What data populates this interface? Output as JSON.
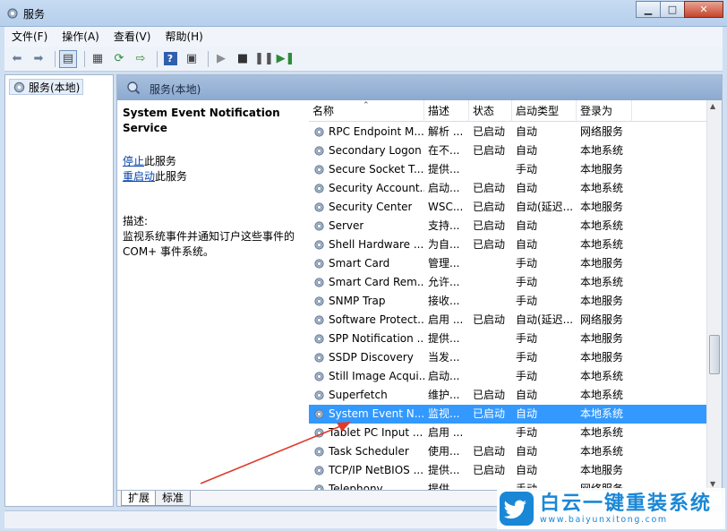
{
  "window": {
    "title": "服务",
    "controls": [
      "minimize-icon",
      "maximize-icon",
      "close-icon"
    ]
  },
  "menu": [
    "文件(F)",
    "操作(A)",
    "查看(V)",
    "帮助(H)"
  ],
  "tree": {
    "root_label": "服务(本地)"
  },
  "panel": {
    "header": "服务(本地)",
    "selected_title": "System Event Notification Service",
    "stop_link": "停止",
    "stop_suffix": "此服务",
    "restart_link": "重启动",
    "restart_suffix": "此服务",
    "desc_label": "描述:",
    "desc_text": "监视系统事件并通知订户这些事件的 COM+ 事件系统。"
  },
  "columns": [
    "名称",
    "描述",
    "状态",
    "启动类型",
    "登录为"
  ],
  "rows": [
    {
      "name": "RPC Endpoint M...",
      "desc": "解析 ...",
      "status": "已启动",
      "type": "自动",
      "logon": "网络服务"
    },
    {
      "name": "Secondary Logon",
      "desc": "在不...",
      "status": "已启动",
      "type": "自动",
      "logon": "本地系统"
    },
    {
      "name": "Secure Socket T...",
      "desc": "提供...",
      "status": "",
      "type": "手动",
      "logon": "本地服务"
    },
    {
      "name": "Security Account...",
      "desc": "启动...",
      "status": "已启动",
      "type": "自动",
      "logon": "本地系统"
    },
    {
      "name": "Security Center",
      "desc": "WSC...",
      "status": "已启动",
      "type": "自动(延迟...",
      "logon": "本地服务"
    },
    {
      "name": "Server",
      "desc": "支持...",
      "status": "已启动",
      "type": "自动",
      "logon": "本地系统"
    },
    {
      "name": "Shell Hardware ...",
      "desc": "为自...",
      "status": "已启动",
      "type": "自动",
      "logon": "本地系统"
    },
    {
      "name": "Smart Card",
      "desc": "管理...",
      "status": "",
      "type": "手动",
      "logon": "本地服务"
    },
    {
      "name": "Smart Card Rem...",
      "desc": "允许...",
      "status": "",
      "type": "手动",
      "logon": "本地系统"
    },
    {
      "name": "SNMP Trap",
      "desc": "接收...",
      "status": "",
      "type": "手动",
      "logon": "本地服务"
    },
    {
      "name": "Software Protect...",
      "desc": "启用 ...",
      "status": "已启动",
      "type": "自动(延迟...",
      "logon": "网络服务"
    },
    {
      "name": "SPP Notification ...",
      "desc": "提供...",
      "status": "",
      "type": "手动",
      "logon": "本地服务"
    },
    {
      "name": "SSDP Discovery",
      "desc": "当发...",
      "status": "",
      "type": "手动",
      "logon": "本地服务"
    },
    {
      "name": "Still Image Acqui...",
      "desc": "启动...",
      "status": "",
      "type": "手动",
      "logon": "本地系统"
    },
    {
      "name": "Superfetch",
      "desc": "维护...",
      "status": "已启动",
      "type": "自动",
      "logon": "本地系统"
    },
    {
      "name": "System Event N...",
      "desc": "监视...",
      "status": "已启动",
      "type": "自动",
      "logon": "本地系统",
      "selected": true
    },
    {
      "name": "Tablet PC Input ...",
      "desc": "启用 ...",
      "status": "",
      "type": "手动",
      "logon": "本地系统"
    },
    {
      "name": "Task Scheduler",
      "desc": "使用...",
      "status": "已启动",
      "type": "自动",
      "logon": "本地系统"
    },
    {
      "name": "TCP/IP NetBIOS ...",
      "desc": "提供...",
      "status": "已启动",
      "type": "自动",
      "logon": "本地服务"
    },
    {
      "name": "Telephony",
      "desc": "提供...",
      "status": "",
      "type": "手动",
      "logon": "网络服务"
    }
  ],
  "tabs": [
    "扩展",
    "标准"
  ],
  "watermark": {
    "main": "白云一键重装系统",
    "sub": "www.baiyunxitong.com"
  },
  "colors": {
    "selection": "#3399ff",
    "link": "#0645ad",
    "annotation_arrow": "#e03a2c",
    "watermark": "#1a87d6"
  }
}
